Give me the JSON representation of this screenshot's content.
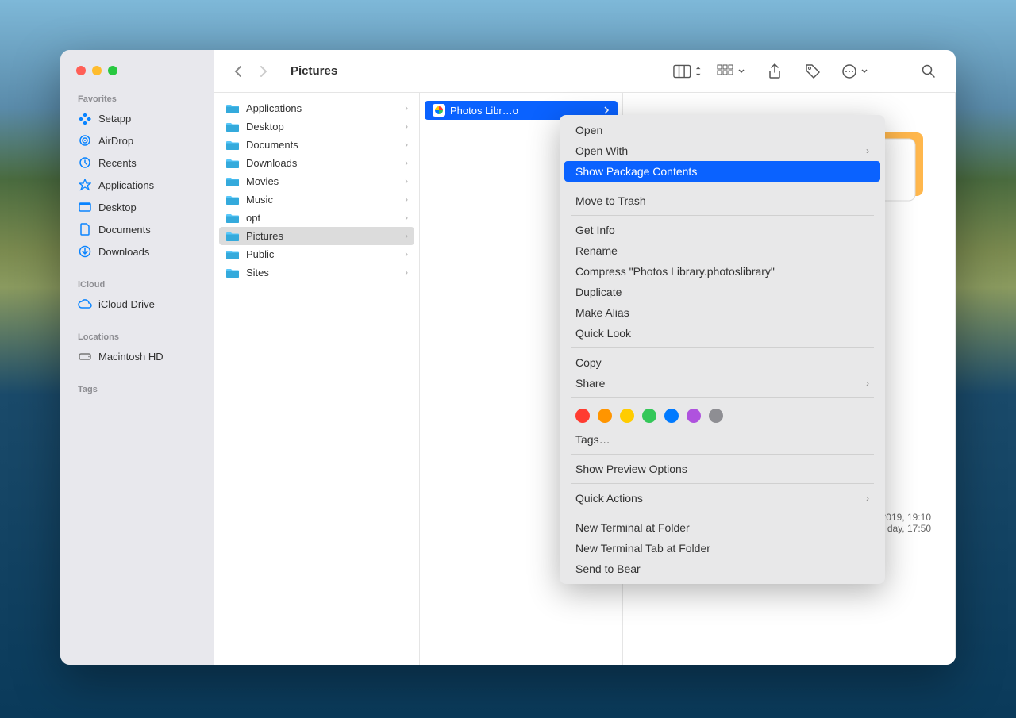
{
  "window": {
    "title": "Pictures"
  },
  "sidebar": {
    "sections": [
      {
        "heading": "Favorites",
        "items": [
          {
            "icon": "setapp",
            "label": "Setapp"
          },
          {
            "icon": "airdrop",
            "label": "AirDrop"
          },
          {
            "icon": "recents",
            "label": "Recents"
          },
          {
            "icon": "applications",
            "label": "Applications"
          },
          {
            "icon": "desktop",
            "label": "Desktop"
          },
          {
            "icon": "documents",
            "label": "Documents"
          },
          {
            "icon": "downloads",
            "label": "Downloads"
          }
        ]
      },
      {
        "heading": "iCloud",
        "items": [
          {
            "icon": "icloud",
            "label": "iCloud Drive"
          }
        ]
      },
      {
        "heading": "Locations",
        "items": [
          {
            "icon": "disk",
            "label": "Macintosh HD"
          }
        ]
      },
      {
        "heading": "Tags",
        "items": []
      }
    ]
  },
  "column1": {
    "items": [
      {
        "label": "Applications",
        "hasChildren": true,
        "selected": false
      },
      {
        "label": "Desktop",
        "hasChildren": true,
        "selected": false
      },
      {
        "label": "Documents",
        "hasChildren": true,
        "selected": false
      },
      {
        "label": "Downloads",
        "hasChildren": true,
        "selected": false
      },
      {
        "label": "Movies",
        "hasChildren": true,
        "selected": false
      },
      {
        "label": "Music",
        "hasChildren": true,
        "selected": false
      },
      {
        "label": "opt",
        "hasChildren": true,
        "selected": false
      },
      {
        "label": "Pictures",
        "hasChildren": true,
        "selected": true
      },
      {
        "label": "Public",
        "hasChildren": true,
        "selected": false
      },
      {
        "label": "Sites",
        "hasChildren": true,
        "selected": false
      }
    ]
  },
  "column2": {
    "items": [
      {
        "label": "Photos Libr…o",
        "selected": true
      }
    ]
  },
  "preview": {
    "lines": [
      "2019, 19:10",
      "day, 17:50"
    ]
  },
  "context_menu": {
    "items": [
      {
        "type": "item",
        "label": "Open"
      },
      {
        "type": "item",
        "label": "Open With",
        "submenu": true
      },
      {
        "type": "item",
        "label": "Show Package Contents",
        "highlighted": true
      },
      {
        "type": "divider"
      },
      {
        "type": "item",
        "label": "Move to Trash"
      },
      {
        "type": "divider"
      },
      {
        "type": "item",
        "label": "Get Info"
      },
      {
        "type": "item",
        "label": "Rename"
      },
      {
        "type": "item",
        "label": "Compress \"Photos Library.photoslibrary\""
      },
      {
        "type": "item",
        "label": "Duplicate"
      },
      {
        "type": "item",
        "label": "Make Alias"
      },
      {
        "type": "item",
        "label": "Quick Look"
      },
      {
        "type": "divider"
      },
      {
        "type": "item",
        "label": "Copy"
      },
      {
        "type": "item",
        "label": "Share",
        "submenu": true
      },
      {
        "type": "divider"
      },
      {
        "type": "tags"
      },
      {
        "type": "item",
        "label": "Tags…"
      },
      {
        "type": "divider"
      },
      {
        "type": "item",
        "label": "Show Preview Options"
      },
      {
        "type": "divider"
      },
      {
        "type": "item",
        "label": "Quick Actions",
        "submenu": true
      },
      {
        "type": "divider"
      },
      {
        "type": "item",
        "label": "New Terminal at Folder"
      },
      {
        "type": "item",
        "label": "New Terminal Tab at Folder"
      },
      {
        "type": "item",
        "label": "Send to Bear"
      }
    ],
    "tag_colors": [
      "#ff3b30",
      "#ff9500",
      "#ffcc00",
      "#34c759",
      "#007aff",
      "#af52de",
      "#8e8e93"
    ]
  }
}
